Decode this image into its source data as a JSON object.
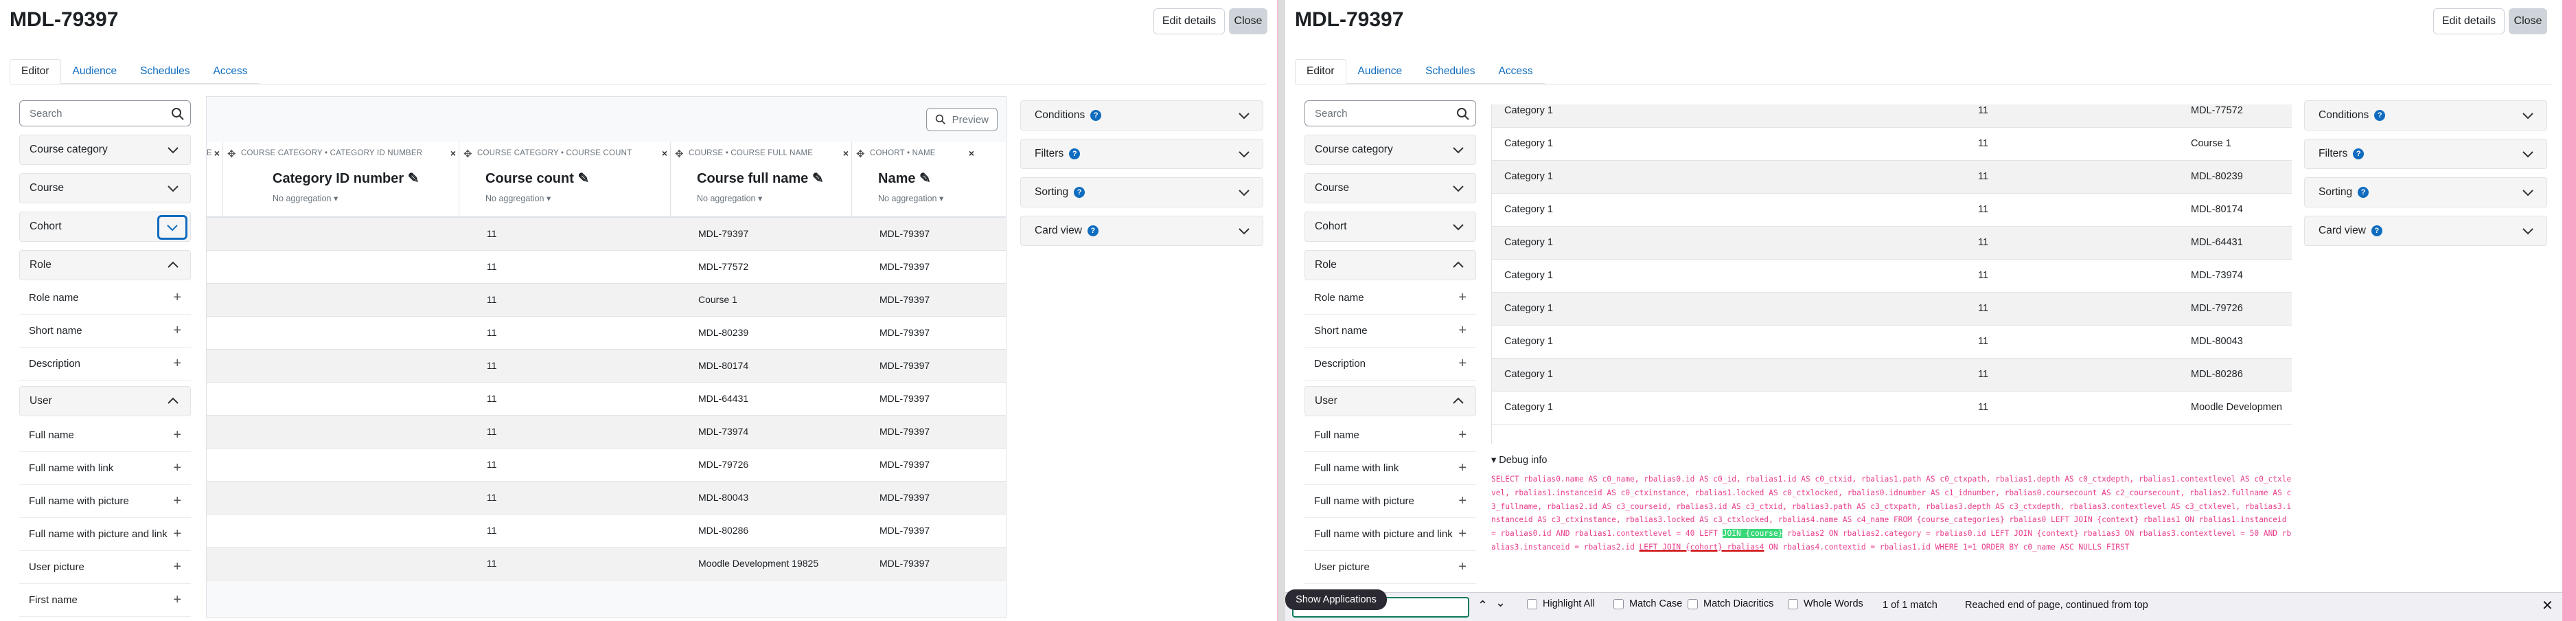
{
  "header": {
    "title": "MDL-79397",
    "edit_label": "Edit details",
    "close_label": "Close"
  },
  "tabs": [
    {
      "label": "Editor"
    },
    {
      "label": "Audience"
    },
    {
      "label": "Schedules"
    },
    {
      "label": "Access"
    }
  ],
  "search": {
    "placeholder": "Search"
  },
  "sidebar": {
    "categories": [
      "Course category",
      "Course",
      "Cohort"
    ],
    "role": {
      "title": "Role",
      "items": [
        "Role name",
        "Short name",
        "Description"
      ]
    },
    "user": {
      "title": "User",
      "items": [
        "Full name",
        "Full name with link",
        "Full name with picture",
        "Full name with picture and link",
        "User picture",
        "First name"
      ]
    }
  },
  "preview_label": "Preview",
  "right_panels": [
    "Conditions",
    "Filters",
    "Sorting",
    "Card view"
  ],
  "columns": [
    {
      "caption": "E",
      "name": ""
    },
    {
      "caption": "Course category • Category ID number",
      "name": "Category ID number",
      "agg": "No aggregation"
    },
    {
      "caption": "Course category • Course count",
      "name": "Course count",
      "agg": "No aggregation"
    },
    {
      "caption": "Course • Course full name",
      "name": "Course full name",
      "agg": "No aggregation"
    },
    {
      "caption": "Cohort • Name",
      "name": "Name",
      "agg": "No aggregation"
    }
  ],
  "left_rows": [
    {
      "count": "11",
      "fullname": "MDL-79397",
      "name": "MDL-79397"
    },
    {
      "count": "11",
      "fullname": "MDL-77572",
      "name": "MDL-79397"
    },
    {
      "count": "11",
      "fullname": "Course 1",
      "name": "MDL-79397"
    },
    {
      "count": "11",
      "fullname": "MDL-80239",
      "name": "MDL-79397"
    },
    {
      "count": "11",
      "fullname": "MDL-80174",
      "name": "MDL-79397"
    },
    {
      "count": "11",
      "fullname": "MDL-64431",
      "name": "MDL-79397"
    },
    {
      "count": "11",
      "fullname": "MDL-73974",
      "name": "MDL-79397"
    },
    {
      "count": "11",
      "fullname": "MDL-79726",
      "name": "MDL-79397"
    },
    {
      "count": "11",
      "fullname": "MDL-80043",
      "name": "MDL-79397"
    },
    {
      "count": "11",
      "fullname": "MDL-80286",
      "name": "MDL-79397"
    },
    {
      "count": "11",
      "fullname": "Moodle Development 19825",
      "name": "MDL-79397"
    }
  ],
  "right_rows": [
    {
      "cat": "Category 1",
      "count": "11",
      "course": "MDL-77572"
    },
    {
      "cat": "Category 1",
      "count": "11",
      "course": "Course 1"
    },
    {
      "cat": "Category 1",
      "count": "11",
      "course": "MDL-80239"
    },
    {
      "cat": "Category 1",
      "count": "11",
      "course": "MDL-80174"
    },
    {
      "cat": "Category 1",
      "count": "11",
      "course": "MDL-64431"
    },
    {
      "cat": "Category 1",
      "count": "11",
      "course": "MDL-73974"
    },
    {
      "cat": "Category 1",
      "count": "11",
      "course": "MDL-79726"
    },
    {
      "cat": "Category 1",
      "count": "11",
      "course": "MDL-80043"
    },
    {
      "cat": "Category 1",
      "count": "11",
      "course": "MDL-80286"
    },
    {
      "cat": "Category 1",
      "count": "11",
      "course": "Moodle Developmen"
    }
  ],
  "debug": {
    "label": "▾ Debug info",
    "sql_a": "SELECT rbalias0.name AS c0_name, rbalias0.id AS c0_id, rbalias1.id AS c0_ctxid, rbalias1.path AS c0_ctxpath, rbalias1.depth AS c0_ctxdepth, rbalias1.contextlevel AS c0_ctxlevel, rbalias1.instanceid AS c0_ctxinstance, rbalias1.locked AS c0_ctxlocked, rbalias0.idnumber AS c1_idnumber, rbalias0.coursecount AS c2_coursecount, rbalias2.fullname AS c3_fullname, rbalias2.id AS c3_courseid, rbalias3.id AS c3_ctxid, rbalias3.path AS c3_ctxpath, rbalias3.depth AS c3_ctxdepth, rbalias3.contextlevel AS c3_ctxlevel, rbalias3.instanceid AS c3_ctxinstance, rbalias3.locked AS c3_ctxlocked, rbalias4.name AS c4_name FROM {course_categories} rbalias0 LEFT JOIN {context} rbalias1 ON rbalias1.instanceid = rbalias0.id AND rbalias1.contextlevel = 40 LEFT ",
    "sql_hl": "JOIN {course}",
    "sql_b": " rbalias2 ON rbalias2.category = rbalias0.id LEFT JOIN {context} rbalias3 ON rbalias3.contextlevel = 50 AND rbalias3.instanceid = rbalias2.id ",
    "sql_ul": "LEFT JOIN {cohort} rbalias4",
    "sql_c": " ON rbalias4.contextid = rbalias1.id WHERE 1=1 ORDER BY c0_name ASC NULLS FIRST"
  },
  "findbar": {
    "tooltip": "Show Applications",
    "highlight_all": "Highlight All",
    "match_case": "Match Case",
    "match_diacritics": "Match Diacritics",
    "whole_words": "Whole Words",
    "matches": "1 of 1 match",
    "status": "Reached end of page, continued from top"
  }
}
